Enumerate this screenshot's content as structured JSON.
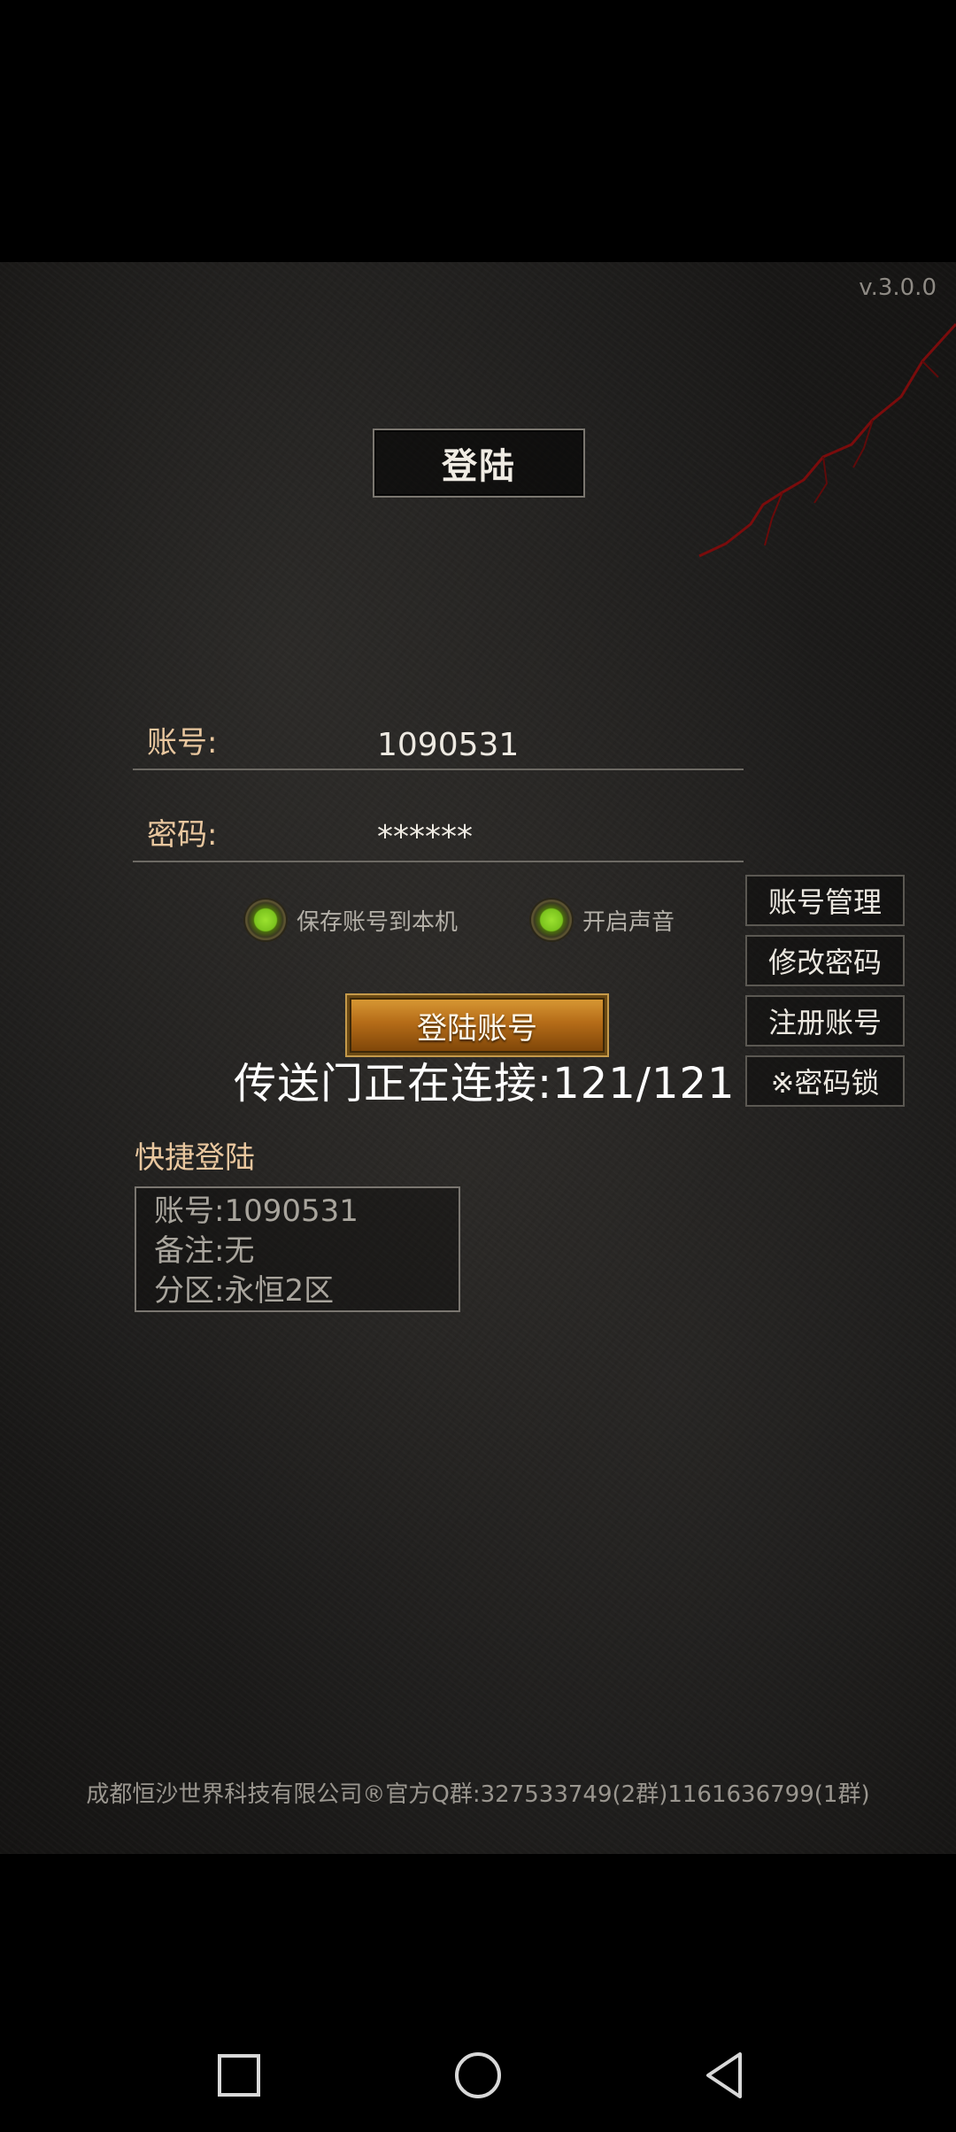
{
  "version": "v.3.0.0",
  "title": "登陆",
  "form": {
    "account_label": "账号:",
    "account_value": "1090531",
    "password_label": "密码:",
    "password_value": "******"
  },
  "options": {
    "save_account_label": "保存账号到本机",
    "sound_label": "开启声音",
    "save_account_on": true,
    "sound_on": true
  },
  "side_buttons": {
    "manage": "账号管理",
    "change_password": "修改密码",
    "register": "注册账号",
    "password_lock": "※密码锁"
  },
  "login_button": "登陆账号",
  "portal_status": "传送门正在连接:121/121",
  "quick_login": {
    "title": "快捷登陆",
    "account_line": "账号:1090531",
    "note_line": "备注:无",
    "zone_line": "分区:永恒2区"
  },
  "footer": "成都恒沙世界科技有限公司®官方Q群:327533749(2群)1161636799(1群)",
  "colors": {
    "label_gold": "#e9c79f",
    "button_orange": "#b56c18",
    "toggle_green": "#9be22f"
  },
  "nav_icons": [
    "recent-apps-icon",
    "home-icon",
    "back-icon"
  ]
}
